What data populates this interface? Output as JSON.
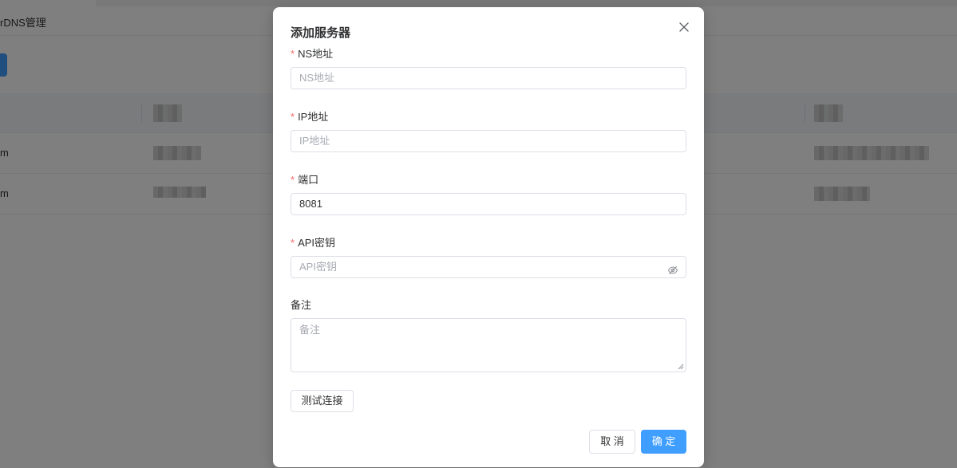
{
  "background": {
    "header_title": "rDNS管理",
    "rows": [
      {
        "first_cell": "m"
      },
      {
        "first_cell": "m"
      }
    ]
  },
  "dialog": {
    "title": "添加服务器",
    "fields": {
      "ns": {
        "label": "NS地址",
        "required": true,
        "value": "",
        "placeholder": "NS地址"
      },
      "ip": {
        "label": "IP地址",
        "required": true,
        "value": "",
        "placeholder": "IP地址"
      },
      "port": {
        "label": "端口",
        "required": true,
        "value": "8081",
        "placeholder": ""
      },
      "api_key": {
        "label": "API密钥",
        "required": true,
        "value": "",
        "placeholder": "API密钥",
        "suffix_icon": "eye-hidden-icon"
      },
      "remark": {
        "label": "备注",
        "required": false,
        "value": "",
        "placeholder": "备注"
      }
    },
    "test_button": "测试连接",
    "cancel_button": "取 消",
    "confirm_button": "确 定",
    "required_mark": "*"
  },
  "colors": {
    "primary": "#409eff",
    "required": "#f56c6c",
    "overlay": "rgba(0,0,0,0.5)"
  }
}
